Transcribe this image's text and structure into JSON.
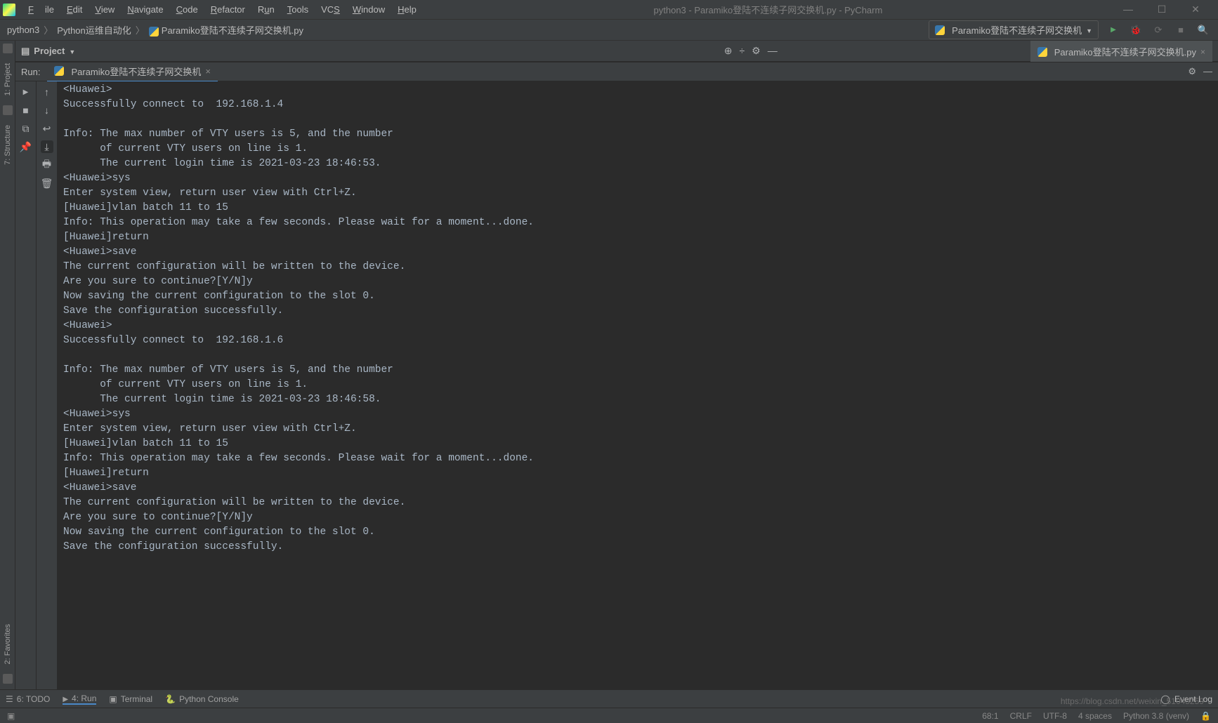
{
  "menu": {
    "file": "File",
    "edit": "Edit",
    "view": "View",
    "navigate": "Navigate",
    "code": "Code",
    "refactor": "Refactor",
    "run": "Run",
    "tools": "Tools",
    "vcs": "VCS",
    "window": "Window",
    "help": "Help"
  },
  "window": {
    "title": "python3 - Paramiko登陆不连续子网交换机.py - PyCharm"
  },
  "breadcrumb": {
    "root": "python3",
    "folder": "Python运维自动化",
    "file": "Paramiko登陆不连续子网交换机.py"
  },
  "run_config": {
    "label": "Paramiko登陆不连续子网交换机"
  },
  "project_tool": {
    "label": "Project"
  },
  "editor_tab": {
    "label": "Paramiko登陆不连续子网交换机.py"
  },
  "side_tabs": {
    "project": "1: Project",
    "structure": "7: Structure",
    "favorites": "2: Favorites"
  },
  "run_panel": {
    "run_label": "Run:",
    "tab_label": "Paramiko登陆不连续子网交换机"
  },
  "console_output": "<Huawei>\nSuccessfully connect to  192.168.1.4\n\nInfo: The max number of VTY users is 5, and the number\n      of current VTY users on line is 1.\n      The current login time is 2021-03-23 18:46:53.\n<Huawei>sys\nEnter system view, return user view with Ctrl+Z.\n[Huawei]vlan batch 11 to 15\nInfo: This operation may take a few seconds. Please wait for a moment...done.\n[Huawei]return\n<Huawei>save\nThe current configuration will be written to the device.\nAre you sure to continue?[Y/N]y\nNow saving the current configuration to the slot 0.\nSave the configuration successfully.\n<Huawei>\nSuccessfully connect to  192.168.1.6\n\nInfo: The max number of VTY users is 5, and the number\n      of current VTY users on line is 1.\n      The current login time is 2021-03-23 18:46:58.\n<Huawei>sys\nEnter system view, return user view with Ctrl+Z.\n[Huawei]vlan batch 11 to 15\nInfo: This operation may take a few seconds. Please wait for a moment...done.\n[Huawei]return\n<Huawei>save\nThe current configuration will be written to the device.\nAre you sure to continue?[Y/N]y\nNow saving the current configuration to the slot 0.\nSave the configuration successfully.",
  "bottom": {
    "todo": "6: TODO",
    "run": "4: Run",
    "terminal": "Terminal",
    "python_console": "Python Console",
    "event_log": "Event Log"
  },
  "status": {
    "pos": "68:1",
    "line_sep": "CRLF",
    "encoding": "UTF-8",
    "indent": "4 spaces",
    "python": "Python 3.8 (venv)"
  },
  "watermark": "https://blog.csdn.net/weixin_51045259"
}
